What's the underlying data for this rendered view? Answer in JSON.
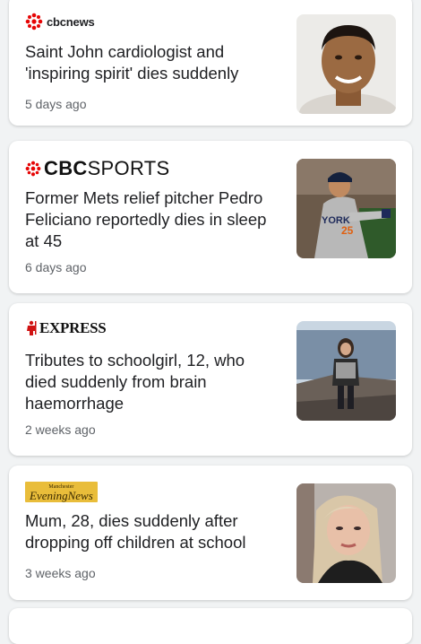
{
  "feed": {
    "items": [
      {
        "source": "cbcnews",
        "headline": "Saint John cardiologist and 'inspiring spirit' dies suddenly",
        "time": "5 days ago",
        "thumbnail_icon": "man-portrait-photo"
      },
      {
        "source_bold": "CBC",
        "source_rest": "SPORTS",
        "headline": "Former Mets relief pitcher Pedro Feliciano reportedly dies in sleep at 45",
        "time": "6 days ago",
        "thumbnail_icon": "baseball-pitcher-photo"
      },
      {
        "source": "EXPRESS",
        "headline": "Tributes to schoolgirl, 12, who died suddenly from brain haemorrhage",
        "time": "2 weeks ago",
        "thumbnail_icon": "girl-by-sea-photo"
      },
      {
        "source_top": "Manchester",
        "source": "EveningNews",
        "headline": "Mum, 28, dies suddenly after dropping off children at school",
        "time": "3 weeks ago",
        "thumbnail_icon": "woman-selfie-photo"
      }
    ]
  },
  "colors": {
    "cbc_red": "#e60505",
    "express_red": "#d01212",
    "men_yellow": "#e9bd3a",
    "background": "#f1f3f4"
  }
}
